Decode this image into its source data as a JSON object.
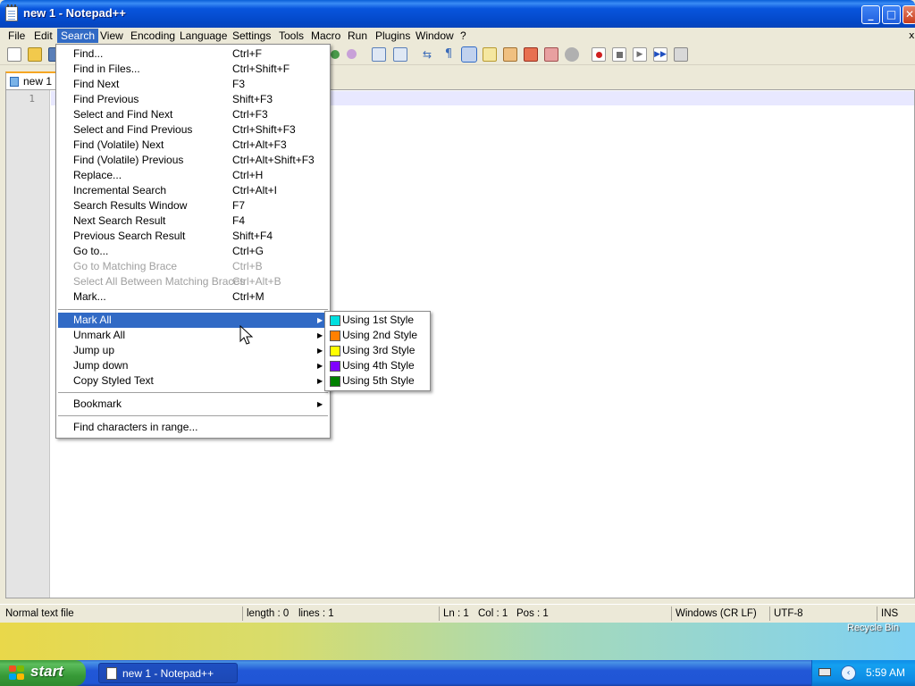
{
  "window": {
    "title": "new 1 - Notepad++"
  },
  "menubar": [
    {
      "label": "File"
    },
    {
      "label": "Edit"
    },
    {
      "label": "Search"
    },
    {
      "label": "View"
    },
    {
      "label": "Encoding"
    },
    {
      "label": "Language"
    },
    {
      "label": "Settings"
    },
    {
      "label": "Tools"
    },
    {
      "label": "Macro"
    },
    {
      "label": "Run"
    },
    {
      "label": "Plugins"
    },
    {
      "label": "Window"
    },
    {
      "label": "?"
    }
  ],
  "menubar_close": "x",
  "tabs": [
    {
      "label": "new 1"
    }
  ],
  "editor": {
    "line_number": "1"
  },
  "search_menu": {
    "items": [
      {
        "label": "Find...",
        "shortcut": "Ctrl+F"
      },
      {
        "label": "Find in Files...",
        "shortcut": "Ctrl+Shift+F"
      },
      {
        "label": "Find Next",
        "shortcut": "F3"
      },
      {
        "label": "Find Previous",
        "shortcut": "Shift+F3"
      },
      {
        "label": "Select and Find Next",
        "shortcut": "Ctrl+F3"
      },
      {
        "label": "Select and Find Previous",
        "shortcut": "Ctrl+Shift+F3"
      },
      {
        "label": "Find (Volatile) Next",
        "shortcut": "Ctrl+Alt+F3"
      },
      {
        "label": "Find (Volatile) Previous",
        "shortcut": "Ctrl+Alt+Shift+F3"
      },
      {
        "label": "Replace...",
        "shortcut": "Ctrl+H"
      },
      {
        "label": "Incremental Search",
        "shortcut": "Ctrl+Alt+I"
      },
      {
        "label": "Search Results Window",
        "shortcut": "F7"
      },
      {
        "label": "Next Search Result",
        "shortcut": "F4"
      },
      {
        "label": "Previous Search Result",
        "shortcut": "Shift+F4"
      },
      {
        "label": "Go to...",
        "shortcut": "Ctrl+G"
      },
      {
        "label": "Go to Matching Brace",
        "shortcut": "Ctrl+B",
        "disabled": true
      },
      {
        "label": "Select All Between Matching Braces",
        "shortcut": "Ctrl+Alt+B",
        "disabled": true
      },
      {
        "label": "Mark...",
        "shortcut": "Ctrl+M"
      }
    ],
    "submenus": [
      {
        "label": "Mark All",
        "highlighted": true
      },
      {
        "label": "Unmark All"
      },
      {
        "label": "Jump up"
      },
      {
        "label": "Jump down"
      },
      {
        "label": "Copy Styled Text"
      }
    ],
    "bookmark": {
      "label": "Bookmark"
    },
    "find_chars": {
      "label": "Find characters in range..."
    }
  },
  "mark_all_submenu": [
    {
      "label": "Using 1st Style",
      "color": "#00e0e0"
    },
    {
      "label": "Using 2nd Style",
      "color": "#ff8000"
    },
    {
      "label": "Using 3rd Style",
      "color": "#ffff00"
    },
    {
      "label": "Using 4th Style",
      "color": "#8000ff"
    },
    {
      "label": "Using 5th Style",
      "color": "#008000"
    }
  ],
  "statusbar": {
    "file_type": "Normal text file",
    "length": "length : 0",
    "lines": "lines : 1",
    "ln": "Ln : 1",
    "col": "Col : 1",
    "pos": "Pos : 1",
    "eol": "Windows (CR LF)",
    "encoding": "UTF-8",
    "mode": "INS"
  },
  "desktop": {
    "recycle_bin": "Recycle Bin"
  },
  "taskbar": {
    "start": "start",
    "task": "new 1 - Notepad++",
    "clock": "5:59 AM"
  }
}
